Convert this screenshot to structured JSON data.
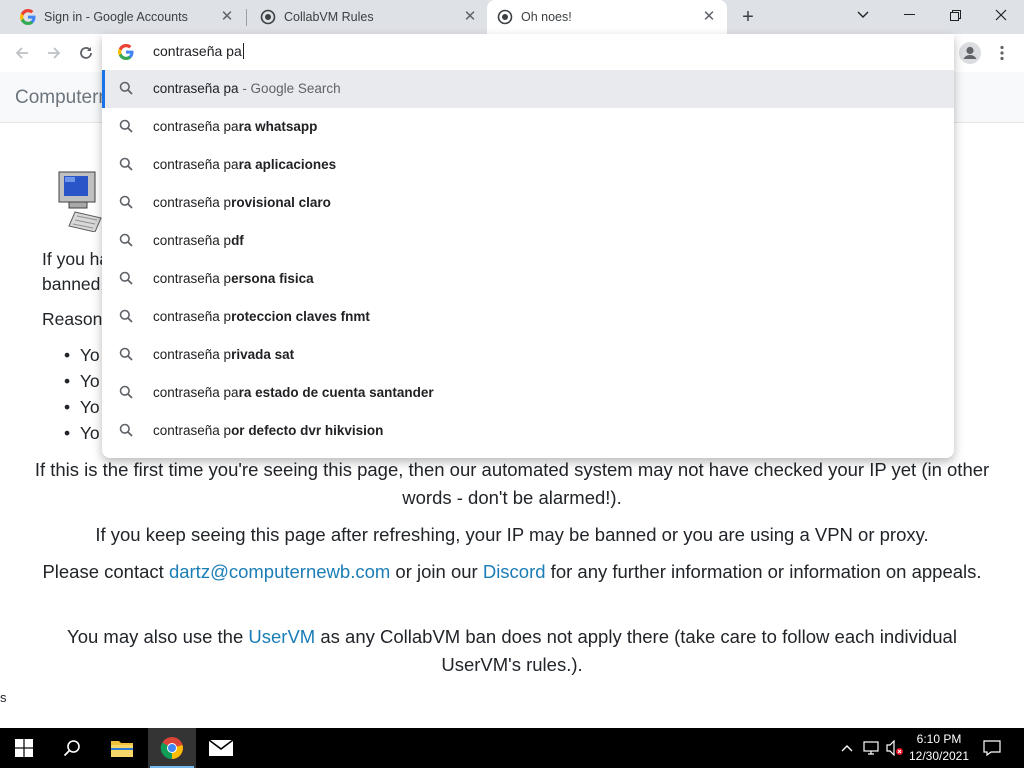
{
  "browser": {
    "tabs": [
      {
        "title": "Sign in - Google Accounts",
        "favicon": "google-g-icon"
      },
      {
        "title": "CollabVM Rules",
        "favicon": "collabvm-icon"
      },
      {
        "title": "Oh noes!",
        "favicon": "collabvm-icon",
        "active": true
      }
    ],
    "omnibox": {
      "value": "contraseña pa",
      "suggestions": [
        {
          "prefix": "contraseña pa",
          "bold": "",
          "suffix": " - Google Search"
        },
        {
          "prefix": "contraseña pa",
          "bold": "ra whatsapp",
          "suffix": ""
        },
        {
          "prefix": "contraseña pa",
          "bold": "ra aplicaciones",
          "suffix": ""
        },
        {
          "prefix": "contraseña p",
          "bold": "rovisional claro",
          "suffix": ""
        },
        {
          "prefix": "contraseña p",
          "bold": "df",
          "suffix": ""
        },
        {
          "prefix": "contraseña p",
          "bold": "ersona fisica",
          "suffix": ""
        },
        {
          "prefix": "contraseña p",
          "bold": "roteccion claves fnmt",
          "suffix": ""
        },
        {
          "prefix": "contraseña p",
          "bold": "rivada sat",
          "suffix": ""
        },
        {
          "prefix": "contraseña pa",
          "bold": "ra estado de cuenta santander",
          "suffix": ""
        },
        {
          "prefix": "contraseña p",
          "bold": "or defecto dvr hikvision",
          "suffix": ""
        }
      ]
    }
  },
  "page": {
    "brand": "Computern",
    "intro_line1": "If you ha",
    "intro_line2": "banned",
    "reasons_heading": "Reason",
    "bullets": [
      "Yo",
      "Yo",
      "Yo",
      "Yo"
    ],
    "p1": "If this is the first time you're seeing this page, then our automated system may not have checked your IP yet (in other words - don't be alarmed!).",
    "p2": "If you keep seeing this page after refreshing, your IP may be banned or you are using a VPN or proxy.",
    "p3_a": "Please contact ",
    "p3_email": "dartz@computernewb.com",
    "p3_b": " or join our ",
    "p3_discord": "Discord",
    "p3_c": " for any further information or information on appeals.",
    "p4_a": "You may also use the ",
    "p4_link": "UserVM",
    "p4_b": " as any CollabVM ban does not apply there (take care to follow each individual UserVM's rules.).",
    "stray_char": "s",
    "link_color": "#1a7db6"
  },
  "taskbar": {
    "clock_time": "6:10 PM",
    "clock_date": "12/30/2021"
  }
}
